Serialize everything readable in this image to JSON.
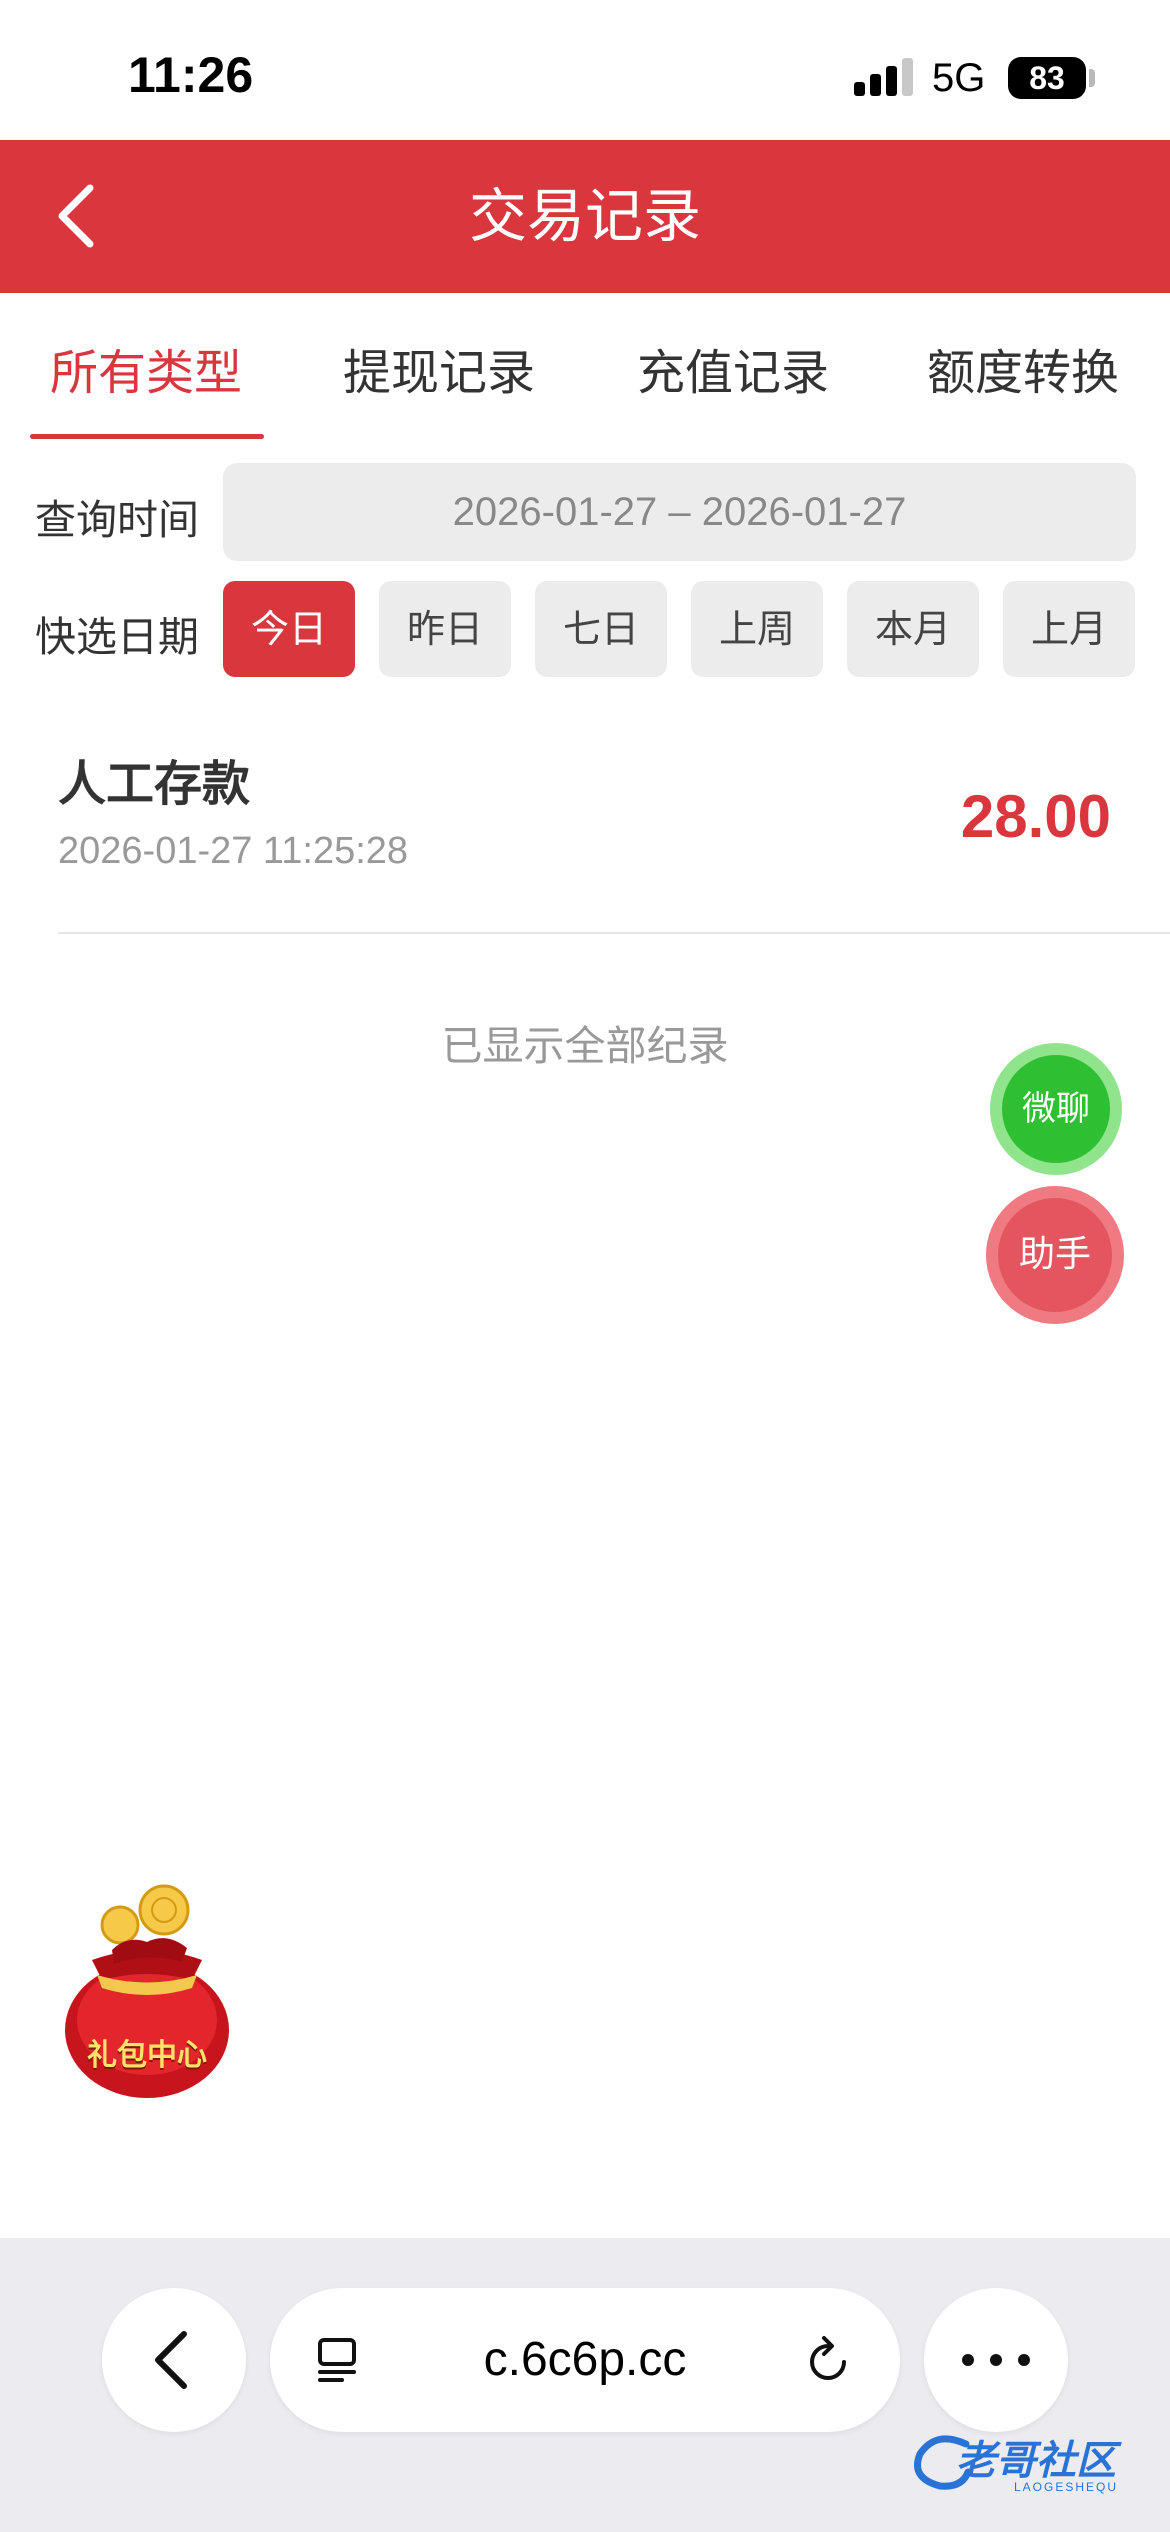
{
  "status_bar": {
    "time": "11:26",
    "network": "5G",
    "battery": "83"
  },
  "header": {
    "title": "交易记录"
  },
  "tabs": [
    {
      "label": "所有类型",
      "active": true
    },
    {
      "label": "提现记录",
      "active": false
    },
    {
      "label": "充值记录",
      "active": false
    },
    {
      "label": "额度转换",
      "active": false
    }
  ],
  "filters": {
    "query_time_label": "查询时间",
    "date_range": "2026-01-27 – 2026-01-27",
    "quick_label": "快选日期",
    "quick_options": [
      "今日",
      "昨日",
      "七日",
      "上周",
      "本月",
      "上月"
    ],
    "quick_selected": "今日"
  },
  "records": [
    {
      "title": "人工存款",
      "time": "2026-01-27 11:25:28",
      "amount": "28.00"
    }
  ],
  "end_text": "已显示全部纪录",
  "floating": {
    "chat_label": "微聊",
    "help_label": "助手"
  },
  "gift": {
    "label": "礼包中心"
  },
  "browser": {
    "url": "c.6c6p.cc"
  },
  "watermark": {
    "text": "老哥社区",
    "sub": "LAOGESHEQU"
  },
  "colors": {
    "primary": "#d9363e",
    "chat": "#2fbf32",
    "help": "#e4555f"
  }
}
